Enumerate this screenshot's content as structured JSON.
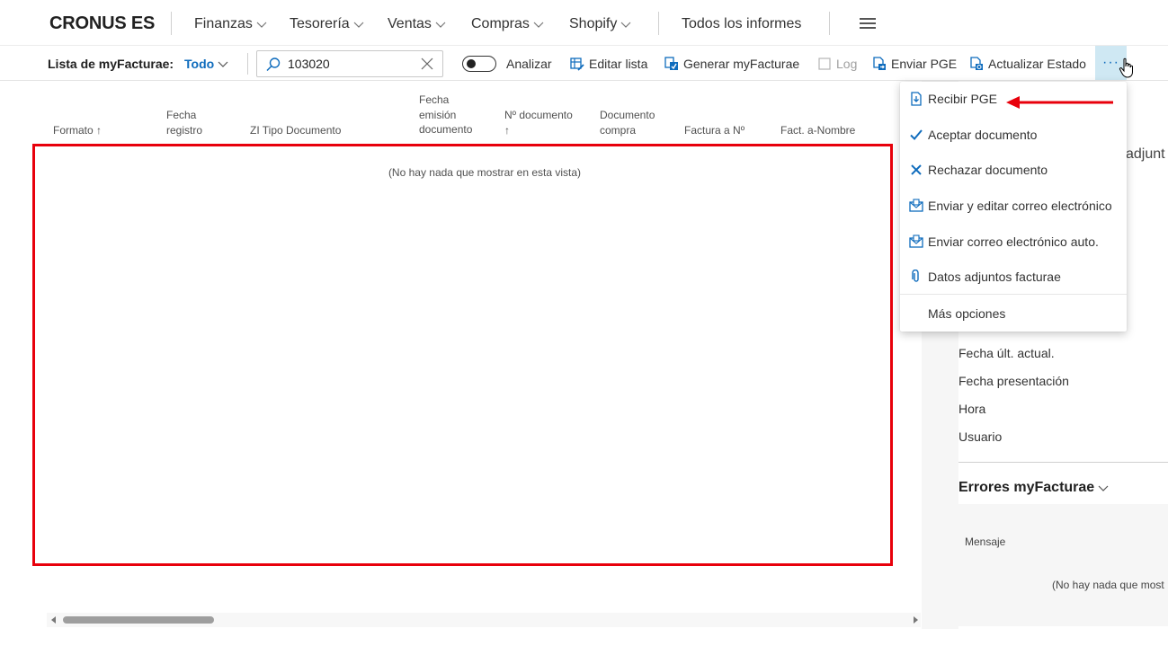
{
  "nav": {
    "brand": "CRONUS ES",
    "items": [
      {
        "label": "Finanzas"
      },
      {
        "label": "Tesorería"
      },
      {
        "label": "Ventas"
      },
      {
        "label": "Compras"
      },
      {
        "label": "Shopify"
      }
    ],
    "all_reports": "Todos los informes"
  },
  "actionbar": {
    "list_title": "Lista de myFacturae:",
    "filter_view": "Todo",
    "search": {
      "value": "103020",
      "placeholder": ""
    },
    "analyze_label": "Analizar",
    "edit_list_label": "Editar lista",
    "generate_label": "Generar myFacturae",
    "log_label": "Log",
    "send_pge_label": "Enviar PGE",
    "update_status_label": "Actualizar Estado",
    "more_label": "···"
  },
  "columns": {
    "formato": [
      "Formato ↑"
    ],
    "fecha_registro": [
      "Fecha",
      "registro"
    ],
    "tipo_documento": [
      "ZI Tipo Documento"
    ],
    "fecha_emision": [
      "Fecha",
      "emisión",
      "documento"
    ],
    "n_documento": [
      "Nº documento",
      "↑"
    ],
    "documento_compra": [
      "Documento",
      "compra"
    ],
    "factura_a": [
      "Factura a Nº"
    ],
    "fact_nombre": [
      "Fact. a-Nombre"
    ]
  },
  "list": {
    "empty_message": "(No hay nada que mostrar en esta vista)"
  },
  "menu": {
    "items": [
      {
        "label": "Recibir PGE",
        "icon": "document-receive-icon"
      },
      {
        "label": "Aceptar documento",
        "icon": "check-icon"
      },
      {
        "label": "Rechazar documento",
        "icon": "x-icon"
      },
      {
        "label": "Enviar y editar correo electrónico",
        "icon": "email-icon"
      },
      {
        "label": "Enviar correo electrónico auto.",
        "icon": "email-icon"
      },
      {
        "label": "Datos adjuntos facturae",
        "icon": "paperclip-icon"
      }
    ],
    "more_options": "Más opciones"
  },
  "factbox": {
    "partial_header": "adjunt",
    "fields": [
      "Fecha últ. actual.",
      "Fecha presentación",
      "Hora",
      "Usuario"
    ],
    "errors_title": "Errores myFacturae",
    "errors_column": "Mensaje",
    "errors_empty": "(No hay nada que most"
  },
  "colors": {
    "accent": "#0f6cbd",
    "highlight": "#e8000b",
    "more_button_bg": "#cfe8f3"
  }
}
